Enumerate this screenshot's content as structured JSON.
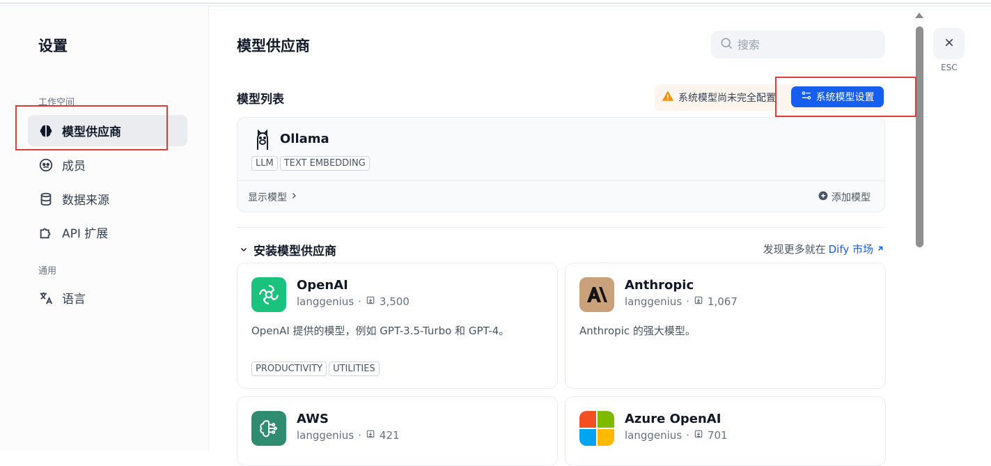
{
  "sidebar": {
    "title": "设置",
    "workspace_label": "工作空间",
    "general_label": "通用",
    "items": [
      {
        "label": "模型供应商",
        "icon": "brain-icon"
      },
      {
        "label": "成员",
        "icon": "members-icon"
      },
      {
        "label": "数据来源",
        "icon": "database-icon"
      },
      {
        "label": "API 扩展",
        "icon": "puzzle-icon"
      }
    ],
    "language": {
      "label": "语言",
      "icon": "translate-icon"
    }
  },
  "main": {
    "title": "模型供应商",
    "search_placeholder": "搜索",
    "model_list_title": "模型列表",
    "warning_text": "系统模型尚未完全配置",
    "system_settings_label": "系统模型设置",
    "provider": {
      "name": "Ollama",
      "tags": [
        "LLM",
        "TEXT EMBEDDING"
      ],
      "show_models": "显示模型",
      "add_model": "添加模型"
    },
    "install_title": "安装模型供应商",
    "discover_prefix": "发现更多就在",
    "discover_link": "Dify 市场",
    "cards": [
      {
        "name": "OpenAI",
        "author": "langgenius",
        "installs": "3,500",
        "desc": "OpenAI 提供的模型，例如 GPT-3.5-Turbo 和 GPT-4。",
        "tags": [
          "PRODUCTIVITY",
          "UTILITIES"
        ]
      },
      {
        "name": "Anthropic",
        "author": "langgenius",
        "installs": "1,067",
        "desc": "Anthropic 的强大模型。",
        "tags": []
      },
      {
        "name": "AWS",
        "author": "langgenius",
        "installs": "421"
      },
      {
        "name": "Azure OpenAI",
        "author": "langgenius",
        "installs": "701"
      }
    ]
  },
  "close": {
    "esc_label": "ESC"
  },
  "colors": {
    "accent": "#155eef",
    "warning": "#f79009",
    "highlight": "#e53935"
  }
}
